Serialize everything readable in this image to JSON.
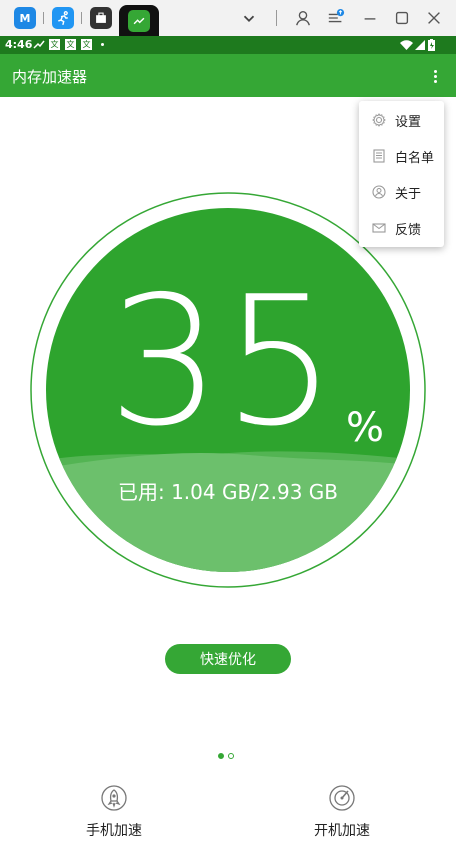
{
  "statusbar": {
    "time": "4:46",
    "notif_glyph": "文"
  },
  "appbar": {
    "title": "内存加速器"
  },
  "gauge": {
    "percent": "35",
    "percent_sign": "%",
    "used_label": "已用: 1.04 GB/2.93 GB",
    "fill_level": 0.35
  },
  "actions": {
    "optimize_label": "快速优化"
  },
  "pager": {
    "count": 2,
    "active_index": 0
  },
  "bottom_nav": {
    "phone_boost": "手机加速",
    "boot_boost": "开机加速"
  },
  "menu": {
    "items": [
      {
        "label": "设置",
        "icon": "gear-icon"
      },
      {
        "label": "白名单",
        "icon": "document-icon"
      },
      {
        "label": "关于",
        "icon": "person-icon"
      },
      {
        "label": "反馈",
        "icon": "mail-icon"
      }
    ]
  },
  "colors": {
    "accent": "#35a735",
    "accent_dark": "#2a9e2a",
    "wave_light": "#6cc06c",
    "statusbar": "#1e7a1e"
  }
}
